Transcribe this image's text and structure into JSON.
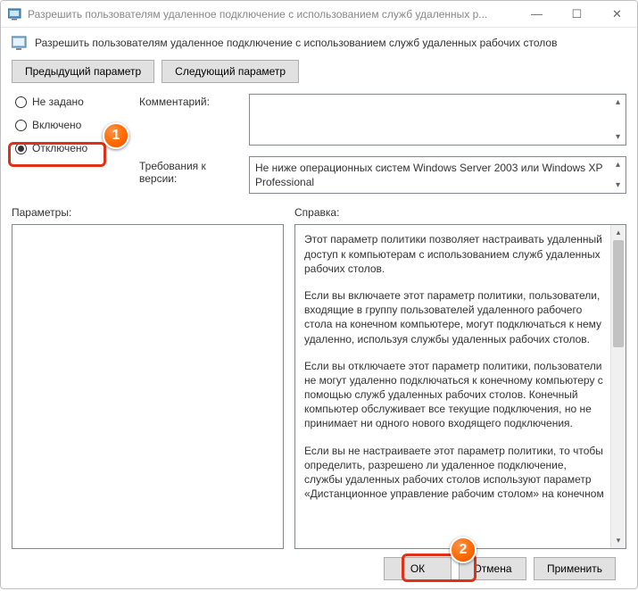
{
  "titlebar": {
    "text": "Разрешить пользователям удаленное подключение с использованием служб удаленных р..."
  },
  "header": {
    "text": "Разрешить пользователям удаленное подключение с использованием служб удаленных рабочих столов"
  },
  "nav": {
    "prev": "Предыдущий параметр",
    "next": "Следующий параметр"
  },
  "radios": {
    "not_configured": "Не задано",
    "enabled": "Включено",
    "disabled": "Отключено"
  },
  "labels": {
    "comment": "Комментарий:",
    "requirements": "Требования к версии:",
    "params": "Параметры:",
    "help": "Справка:"
  },
  "requirements_text": "Не ниже операционных систем Windows Server 2003 или Windows XP Professional",
  "help": {
    "p1": "Этот параметр политики позволяет настраивать удаленный доступ к компьютерам с использованием служб удаленных рабочих столов.",
    "p2": "Если вы включаете этот параметр политики, пользователи, входящие в группу пользователей удаленного рабочего стола на конечном компьютере, могут подключаться к нему удаленно, используя службы удаленных рабочих столов.",
    "p3": "Если вы отключаете этот параметр политики, пользователи не могут удаленно подключаться к конечному компьютеру с помощью служб удаленных рабочих столов. Конечный компьютер обслуживает все текущие подключения, но не принимает ни одного нового входящего подключения.",
    "p4": "Если вы не настраиваете этот параметр политики, то чтобы определить, разрешено ли удаленное подключение, службы удаленных рабочих столов используют параметр «Дистанционное управление рабочим столом» на конечном"
  },
  "buttons": {
    "ok": "ОК",
    "cancel": "Отмена",
    "apply": "Применить"
  },
  "markers": {
    "one": "1",
    "two": "2"
  }
}
